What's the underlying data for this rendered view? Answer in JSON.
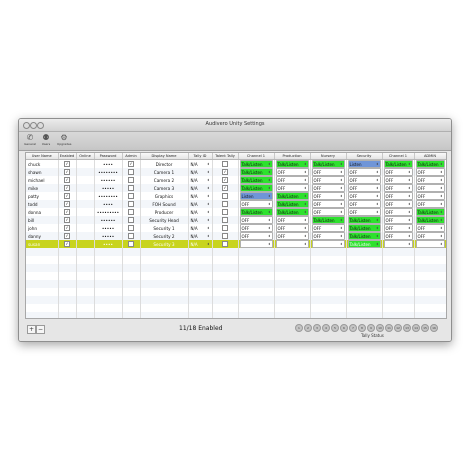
{
  "window": {
    "title": "Audivero Unity Settings"
  },
  "toolbar": {
    "items": [
      {
        "label": "General",
        "icon": "phone-icon"
      },
      {
        "label": "Users",
        "icon": "users-icon"
      },
      {
        "label": "Upgrades",
        "icon": "gear-icon"
      }
    ]
  },
  "table": {
    "headers": [
      "User Name",
      "Enabled",
      "Online",
      "Password",
      "Admin",
      "Display Name",
      "Tally ID",
      "Talent Tally",
      "Channel 1",
      "Production",
      "Nursery",
      "Security",
      "Channel 1",
      "ADMIN"
    ],
    "rows": [
      {
        "user": "chuck",
        "enabled": true,
        "password": "••••",
        "admin": true,
        "display": "Director",
        "tally": "N/A",
        "talent": false,
        "ch": [
          "Talk/Listen",
          "Talk/Listen",
          "Talk/Listen",
          "Listen",
          "Talk/Listen",
          "Talk/Listen"
        ]
      },
      {
        "user": "shawn",
        "enabled": true,
        "password": "••••••••",
        "admin": false,
        "display": "Camera 1",
        "tally": "N/A",
        "talent": true,
        "ch": [
          "Talk/Listen",
          "OFF",
          "OFF",
          "OFF",
          "OFF",
          "OFF"
        ]
      },
      {
        "user": "michael",
        "enabled": true,
        "password": "••••••",
        "admin": false,
        "display": "Camera 2",
        "tally": "N/A",
        "talent": true,
        "ch": [
          "Talk/Listen",
          "OFF",
          "OFF",
          "OFF",
          "OFF",
          "OFF"
        ]
      },
      {
        "user": "mike",
        "enabled": true,
        "password": "•••••",
        "admin": false,
        "display": "Camera 3",
        "tally": "N/A",
        "talent": true,
        "ch": [
          "Talk/Listen",
          "OFF",
          "OFF",
          "OFF",
          "OFF",
          "OFF"
        ]
      },
      {
        "user": "patty",
        "enabled": true,
        "password": "••••••••",
        "admin": false,
        "display": "Graphics",
        "tally": "N/A",
        "talent": false,
        "ch": [
          "Listen",
          "Talk/Listen",
          "OFF",
          "OFF",
          "OFF",
          "OFF"
        ]
      },
      {
        "user": "todd",
        "enabled": true,
        "password": "••••",
        "admin": false,
        "display": "FOH Sound",
        "tally": "N/A",
        "talent": false,
        "ch": [
          "OFF",
          "Talk/Listen",
          "OFF",
          "OFF",
          "OFF",
          "OFF"
        ]
      },
      {
        "user": "donna",
        "enabled": true,
        "password": "•••••••••",
        "admin": false,
        "display": "Producer",
        "tally": "N/A",
        "talent": false,
        "ch": [
          "Talk/Listen",
          "Talk/Listen",
          "OFF",
          "OFF",
          "OFF",
          "Talk/Listen"
        ]
      },
      {
        "user": "bill",
        "enabled": true,
        "password": "••••••",
        "admin": false,
        "display": "Security Head",
        "tally": "N/A",
        "talent": false,
        "ch": [
          "OFF",
          "OFF",
          "Talk/Listen",
          "Talk/Listen",
          "OFF",
          "Talk/Listen"
        ]
      },
      {
        "user": "john",
        "enabled": true,
        "password": "•••••",
        "admin": false,
        "display": "Security 1",
        "tally": "N/A",
        "talent": false,
        "ch": [
          "OFF",
          "OFF",
          "OFF",
          "Talk/Listen",
          "OFF",
          "OFF"
        ]
      },
      {
        "user": "danny",
        "enabled": true,
        "password": "•••••",
        "admin": false,
        "display": "Security 2",
        "tally": "N/A",
        "talent": false,
        "ch": [
          "OFF",
          "OFF",
          "OFF",
          "Talk/Listen",
          "OFF",
          "OFF"
        ]
      },
      {
        "user": "susan",
        "enabled": true,
        "password": "••••",
        "admin": false,
        "display": "Security 3",
        "tally": "N/A",
        "talent": false,
        "ch": [
          "OFF",
          "OFF",
          "OFF",
          "Talk/Listen",
          "OFF",
          "OFF"
        ]
      }
    ],
    "selected_row": 10,
    "empty_rows": 12
  },
  "bottom": {
    "add_label": "+",
    "remove_label": "−",
    "status": "11/18 Enabled",
    "tally_label": "Tally Status",
    "tally_lights": [
      "1",
      "2",
      "3",
      "4",
      "5",
      "6",
      "7",
      "8",
      "9",
      "10",
      "11",
      "12",
      "13",
      "14",
      "15",
      "16"
    ]
  },
  "colors": {
    "talk_listen": "#2ee12e",
    "listen": "#6f95d8",
    "selected_row": "#c8d41e"
  }
}
